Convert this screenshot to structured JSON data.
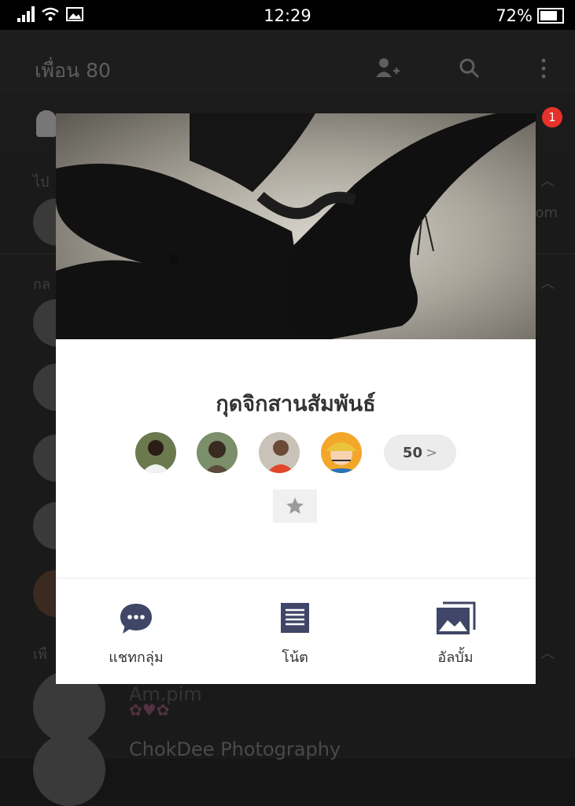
{
  "status_bar": {
    "time": "12:29",
    "battery": "72%",
    "battery_level": 0.72,
    "icons": [
      "signal-icon",
      "wifi-icon",
      "image-notification-icon",
      "battery-icon"
    ]
  },
  "app_header": {
    "title": "เพื่อน 80",
    "icons": [
      "add-friend-icon",
      "search-icon",
      "more-vert-icon"
    ]
  },
  "tabs": {
    "badges": [
      "1"
    ]
  },
  "background_list": {
    "section_top": "ไป",
    "section_groups": "กล",
    "section_friends": "เพื",
    "partial_text": "om",
    "items": [
      {
        "name": "Am.pim"
      },
      {
        "name": "ChokDee Photography"
      }
    ]
  },
  "group_profile": {
    "name": "กุดจิกสานสัมพันธ์",
    "member_count": "50",
    "member_count_arrow": ">",
    "actions": [
      {
        "label": "แชทกลุ่ม",
        "icon": "chat-bubble-icon"
      },
      {
        "label": "โน้ต",
        "icon": "note-icon"
      },
      {
        "label": "อัลบั้ม",
        "icon": "album-icon"
      }
    ]
  },
  "colors": {
    "accent_icon": "#3f4667",
    "badge_red": "#e6322b",
    "overlay_dark": "#151515"
  }
}
